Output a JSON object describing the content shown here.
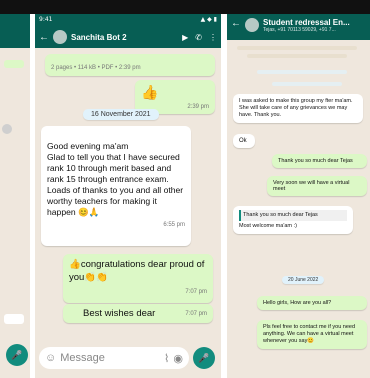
{
  "middle": {
    "status_time": "9:41",
    "chat_title": "Sanchita Bot 2",
    "doc_meta": "2 pages • 114 kB • PDF • 2:39 pm",
    "emoji_msg": {
      "text": "👍",
      "time": "2:39 pm"
    },
    "date_pill": "16 November 2021",
    "incoming": {
      "text": "Good evening ma'am\nGlad to tell you that I have secured rank 10 through merit based and rank 15 through entrance exam. Loads of thanks to you and all other worthy teachers for making it happen 😊🙏",
      "time": "6:55 pm"
    },
    "congrats": {
      "text": "👍congratulations dear proud of you👏👏",
      "time": "7:07 pm"
    },
    "wishes": {
      "text": "Best wishes dear",
      "time": "7:07 pm"
    },
    "composer_placeholder": "Message"
  },
  "right": {
    "chat_title": "Student redressal En...",
    "subtitle": "Tejas, +91 70113 59029, +91 7...",
    "messages": [
      {
        "text": "I was asked to make this group my fter ma'am. She will take care of any grievances we may have. Thank you.",
        "side": "in"
      },
      {
        "text": "Ok",
        "side": "in"
      },
      {
        "text": "Thank you so much dear Tejas",
        "side": "out"
      },
      {
        "text": "Very soon we will have a virtual meet",
        "side": "out"
      },
      {
        "text": "Thank you so much dear Tejas",
        "side": "in"
      },
      {
        "text": "Most welcome ma'am :)",
        "side": "in"
      },
      {
        "text": "Hello girls, How are you all?",
        "side": "out"
      },
      {
        "text": "Pls feel free to contact me if you need anything. We can have a virtual meet whenever you say😊",
        "side": "out"
      }
    ],
    "date_pill": "20 June 2022"
  },
  "colors": {
    "header": "#075e54",
    "outgoing_bubble": "#dcf8c6",
    "incoming_bubble": "#ffffff",
    "wallpaper": "#efe7dd",
    "accent": "#128c7e"
  }
}
